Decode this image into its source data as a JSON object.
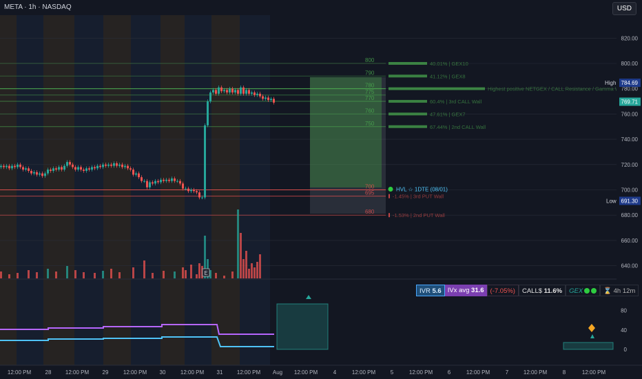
{
  "header": {
    "symbol": "META · 1h · NASDAQ",
    "currency": "USD"
  },
  "price_axis": {
    "ticks": [
      "820.00",
      "800.00",
      "780.00",
      "760.00",
      "740.00",
      "720.00",
      "700.00",
      "680.00",
      "660.00",
      "640.00"
    ],
    "high_label": "High",
    "high_value": "784.69",
    "last_value": "769.71",
    "low_label": "Low",
    "low_value": "691.30"
  },
  "indicator_axis": {
    "ticks": [
      "120",
      "80",
      "40",
      "0"
    ]
  },
  "time_axis": {
    "labels": [
      "12:00 PM",
      "28",
      "12:00 PM",
      "29",
      "12:00 PM",
      "30",
      "12:00 PM",
      "31",
      "12:00 PM",
      "Aug",
      "12:00 PM",
      "4",
      "12:00 PM",
      "5",
      "12:00 PM",
      "6",
      "12:00 PM",
      "7",
      "12:00 PM",
      "8",
      "12:00 PM"
    ]
  },
  "levels": [
    {
      "value": "800",
      "text": "40.01% | GEX10"
    },
    {
      "value": "790",
      "text": "41.12% | GEX8"
    },
    {
      "value": "780",
      "text": "Highest positive NETGEX / CALL Resistance / Gamma W"
    },
    {
      "value": "775",
      "text": ""
    },
    {
      "value": "770",
      "text": "60.4% | 3rd CALL Wall"
    },
    {
      "value": "760",
      "text": "47.61% | GEX7"
    },
    {
      "value": "750",
      "text": "67.44% | 2nd CALL Wall"
    },
    {
      "value": "700",
      "text": "HVL ☆ 1DTE (08/01)"
    },
    {
      "value": "695",
      "text": "-1.45% | 3rd PUT Wall"
    },
    {
      "value": "680",
      "text": "-1.53% | 2nd PUT Wall"
    }
  ],
  "widget": {
    "ivr_label": "IVR",
    "ivr_value": "5.6",
    "ivx_label": "IVx avg",
    "ivx_value": "31.6",
    "change": "(-7.05%)",
    "call_label": "CALL$",
    "call_value": "11.6%",
    "gex_label": "GEX",
    "timer": "4h 12m"
  },
  "colors": {
    "background": "#131722",
    "up": "#26a69a",
    "down": "#ef5350",
    "call_level": "#4caf50",
    "put_level": "#ef5350",
    "ivx_line": "#b666ff",
    "iv_line": "#4fc3f7"
  }
}
